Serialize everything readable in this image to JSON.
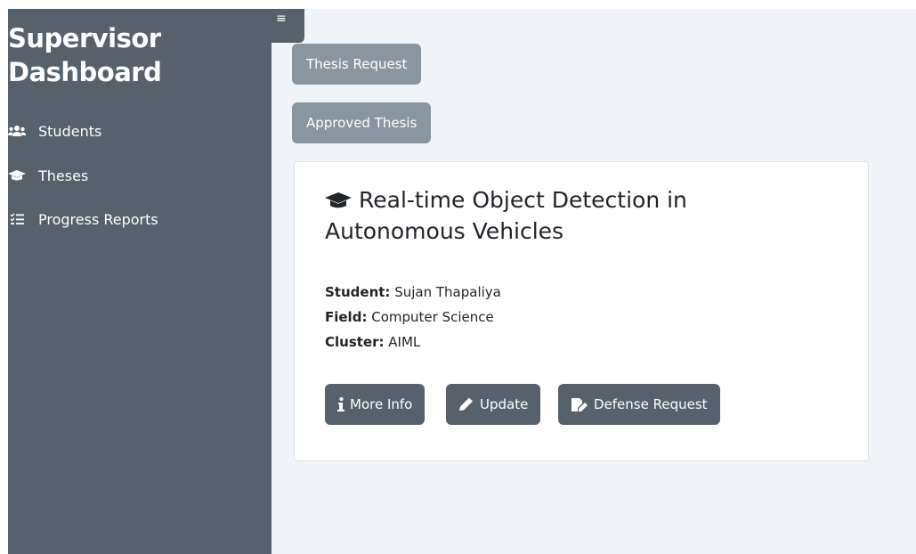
{
  "sidebar": {
    "title_line1": "Supervisor",
    "title_line2": "Dashboard",
    "items": [
      {
        "label": "Students",
        "icon": "users-icon"
      },
      {
        "label": "Theses",
        "icon": "graduation-cap-icon"
      },
      {
        "label": "Progress Reports",
        "icon": "list-check-icon"
      }
    ],
    "toggle_glyph": "≡"
  },
  "tabs": {
    "thesis_request": "Thesis Request",
    "approved_thesis": "Approved Thesis"
  },
  "thesis": {
    "title": "Real-time Object Detection in Autonomous Vehicles",
    "student_label": "Student:",
    "student": "Sujan Thapaliya",
    "field_label": "Field:",
    "field": "Computer Science",
    "cluster_label": "Cluster:",
    "cluster": "AIML"
  },
  "actions": {
    "more_info": "More Info",
    "update": "Update",
    "defense_request": "Defense Request"
  },
  "colors": {
    "sidebar_bg": "#56616b",
    "page_bg": "#f0f4f8",
    "tab_bg": "#8a969f",
    "action_bg": "#56616b"
  }
}
